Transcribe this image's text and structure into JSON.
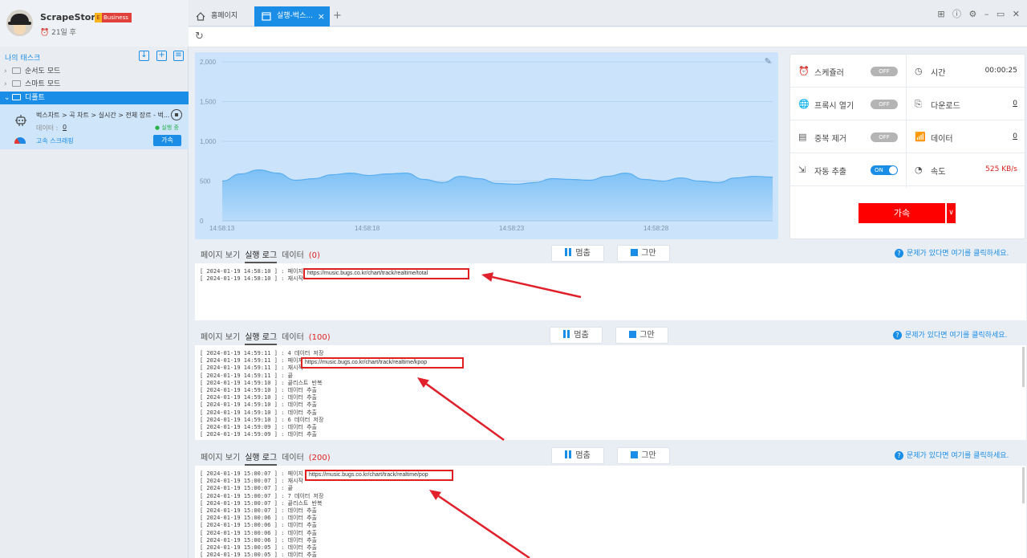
{
  "profile": {
    "app_name": "ScrapeStorm",
    "badge_letter": "E",
    "badge": "Business",
    "expiry": "21일 후"
  },
  "tasks": {
    "title": "나의 태스크",
    "tree": [
      "순서도 모드",
      "스마트 모드",
      "디폴트"
    ],
    "task": {
      "name": "벅스차트 > 곡 차트 > 실시간 > 전체 장르 - 벅...",
      "data_label": "데이터 :",
      "data_value": "0",
      "status": "● 실행 중",
      "speed_label": "고속 스크래핑",
      "accel": "가속"
    }
  },
  "tabs": {
    "home": "홈페이지",
    "run": "실행-벅스...",
    "close": "×",
    "add": "+"
  },
  "window_controls": "⊞ ⓘ ⚙ – ▭ ✕",
  "chart_data": {
    "type": "area",
    "y_ticks": [
      "2,000",
      "1,500",
      "1,000",
      "500",
      "0"
    ],
    "x_ticks": [
      "14:58:13",
      "14:58:18",
      "14:58:23",
      "14:58:28"
    ],
    "ylim": [
      0,
      2000
    ],
    "grid": true,
    "values": [
      500,
      590,
      640,
      600,
      510,
      530,
      580,
      600,
      570,
      590,
      600,
      520,
      480,
      560,
      530,
      470,
      460,
      480,
      530,
      520,
      510,
      560,
      600,
      520,
      500,
      540,
      500,
      480,
      540,
      560,
      550
    ]
  },
  "stats": {
    "scheduler": {
      "label": "스케쥴러",
      "toggle": "OFF"
    },
    "proxy": {
      "label": "프록시 열기",
      "toggle": "OFF"
    },
    "dedupe": {
      "label": "중복 제거",
      "toggle": "OFF"
    },
    "auto_export": {
      "label": "자동 추출",
      "toggle": "ON"
    },
    "time": {
      "label": "시간",
      "value": "00:00:25"
    },
    "download": {
      "label": "다운로드",
      "value": "0"
    },
    "data": {
      "label": "데이터",
      "value": "0"
    },
    "speed": {
      "label": "속도",
      "value": "525 KB/s"
    },
    "accel": "가속",
    "accel_dropdown": "∨"
  },
  "log_tabs": {
    "page_view": "페이지 보기",
    "run_log": "실행 로그",
    "data": "데이터",
    "pause": "멈춤",
    "stop": "그만",
    "help": "문제가 있다면 여기를 클릭하세요."
  },
  "sections": [
    {
      "count": "(0)",
      "url": "https://music.bugs.co.kr/chart/track/realtime/total",
      "lines": [
        "[ 2024-01-19 14:58:10 ] : 페이지 열기",
        "[ 2024-01-19 14:58:10 ] : 재시작"
      ]
    },
    {
      "count": "(100)",
      "url": "https://music.bugs.co.kr/chart/track/realtime/kpop",
      "lines": [
        "[ 2024-01-19 14:59:11 ] : 4 데이터 저장",
        "[ 2024-01-19 14:59:11 ] : 페이지 열기",
        "[ 2024-01-19 14:59:11 ] : 재시작",
        "[ 2024-01-19 14:59:11 ] : 끝",
        "[ 2024-01-19 14:59:10 ] : 끝리스트 반복",
        "[ 2024-01-19 14:59:10 ] : 데이터 추출",
        "[ 2024-01-19 14:59:10 ] : 데이터 추출",
        "[ 2024-01-19 14:59:10 ] : 데이터 추출",
        "[ 2024-01-19 14:59:10 ] : 데이터 추출",
        "[ 2024-01-19 14:59:10 ] : 6 데이터 저장",
        "[ 2024-01-19 14:59:09 ] : 데이터 추출",
        "[ 2024-01-19 14:59:09 ] : 데이터 추출"
      ]
    },
    {
      "count": "(200)",
      "url": "https://music.bugs.co.kr/chart/track/realtime/pop",
      "lines": [
        "[ 2024-01-19 15:00:07 ] : 페이지 열기",
        "[ 2024-01-19 15:00:07 ] : 재시작",
        "[ 2024-01-19 15:00:07 ] : 끝",
        "[ 2024-01-19 15:00:07 ] : 7 데이터 저장",
        "[ 2024-01-19 15:00:07 ] : 끝리스트 반복",
        "[ 2024-01-19 15:00:07 ] : 데이터 추출",
        "[ 2024-01-19 15:00:06 ] : 데이터 추출",
        "[ 2024-01-19 15:00:06 ] : 데이터 추출",
        "[ 2024-01-19 15:00:06 ] : 데이터 추출",
        "[ 2024-01-19 15:00:06 ] : 데이터 추출",
        "[ 2024-01-19 15:00:05 ] : 데이터 추출",
        "[ 2024-01-19 15:00:05 ] : 데이터 추출"
      ]
    }
  ]
}
